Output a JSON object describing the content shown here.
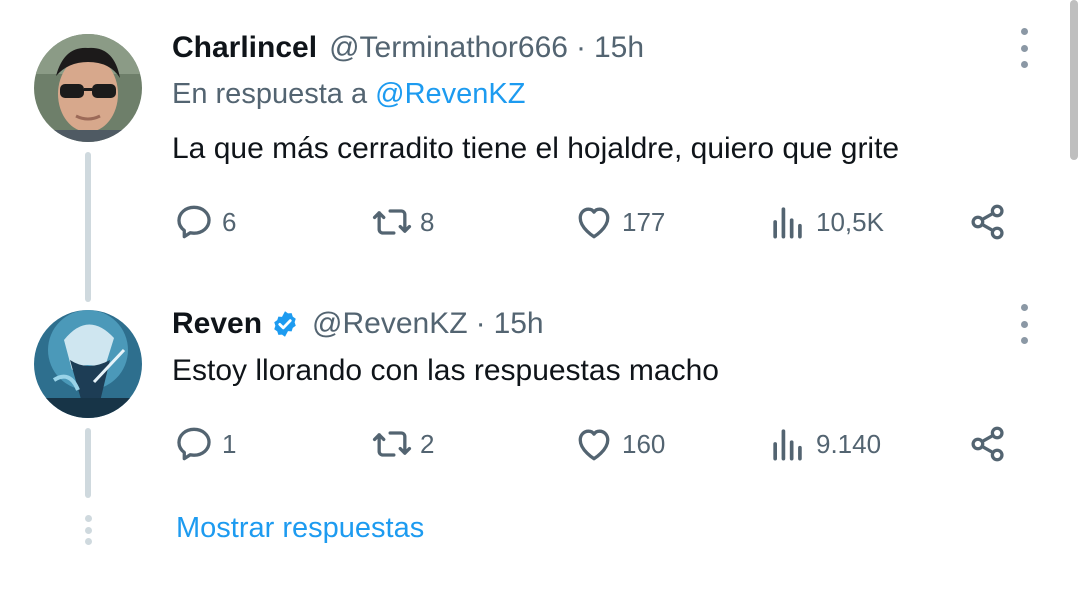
{
  "tweets": [
    {
      "author_name": "Charlincel",
      "handle": "@Terminathor666",
      "separator": "·",
      "time": "15h",
      "reply_prefix": "En respuesta a",
      "reply_to": "@RevenKZ",
      "text": "La que más cerradito tiene el hojaldre, quiero que grite",
      "replies": "6",
      "retweets": "8",
      "likes": "177",
      "views": "10,5K",
      "verified": false
    },
    {
      "author_name": "Reven",
      "handle": "@RevenKZ",
      "separator": "·",
      "time": "15h",
      "text": "Estoy llorando con las respuestas macho",
      "replies": "1",
      "retweets": "2",
      "likes": "160",
      "views": "9.140",
      "verified": true
    }
  ],
  "show_replies_label": "Mostrar respuestas",
  "icons": [
    "reply-icon",
    "retweet-icon",
    "like-icon",
    "views-icon",
    "share-icon",
    "more-icon",
    "verified-badge-icon"
  ],
  "colors": {
    "accent": "#1d9bf0",
    "secondary_text": "#536471",
    "primary_text": "#0f1419",
    "thread_line": "#cfd9de"
  }
}
